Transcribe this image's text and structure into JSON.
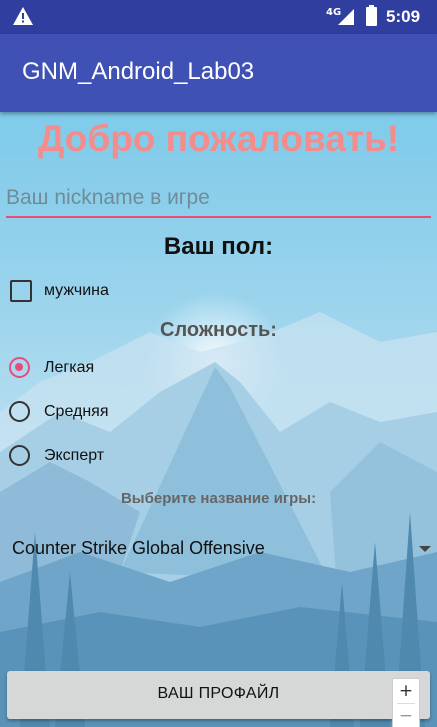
{
  "status_bar": {
    "network": "4G",
    "time": "5:09"
  },
  "app_bar": {
    "title": "GNM_Android_Lab03"
  },
  "welcome_text": "Добро пожаловать!",
  "nickname_input": {
    "placeholder": "Ваш nickname в игре",
    "value": ""
  },
  "gender": {
    "title": "Ваш пол:",
    "checkbox_label": "мужчина",
    "checked": false
  },
  "difficulty": {
    "title": "Сложность:",
    "options": [
      {
        "label": "Легкая",
        "selected": true
      },
      {
        "label": "Средняя",
        "selected": false
      },
      {
        "label": "Эксперт",
        "selected": false
      }
    ]
  },
  "game_select": {
    "title": "Выберите название игры:",
    "selected_value": "Counter Strike Global Offensive"
  },
  "profile_button": {
    "label": "ВАШ ПРОФАЙЛ"
  },
  "zoom_controls": {
    "plus": "+",
    "minus": "−"
  },
  "colors": {
    "primary": "#3F51B5",
    "primary_dark": "#303F9F",
    "accent": "#E84C7A",
    "welcome": "#F48C8C"
  }
}
